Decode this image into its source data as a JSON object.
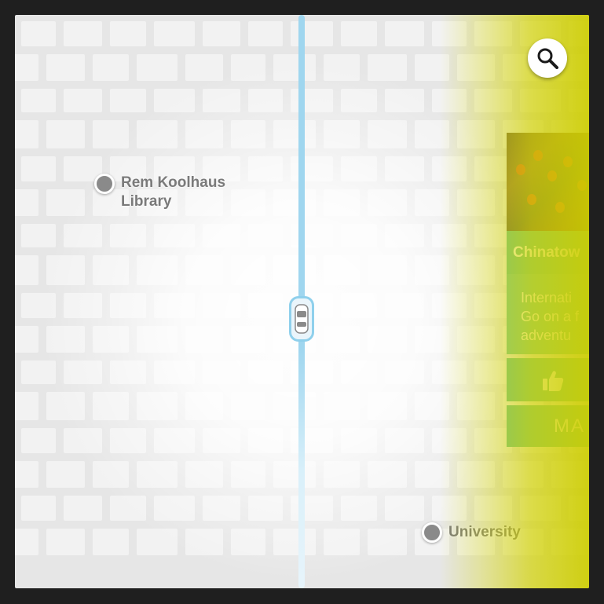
{
  "map": {
    "pois": [
      {
        "name": "Rem Koolhaus\nLibrary"
      },
      {
        "name": "University"
      }
    ],
    "route_color": "#9fd6ef"
  },
  "search": {
    "icon": "search-icon"
  },
  "place_card": {
    "title": "Chinatow",
    "description": "Internati\nGo on a f\nadventu",
    "like_icon": "thumbs-up-icon",
    "more_label": "MA",
    "accent_color": "#5fbf9a"
  },
  "overlay_color": "#d4d400"
}
